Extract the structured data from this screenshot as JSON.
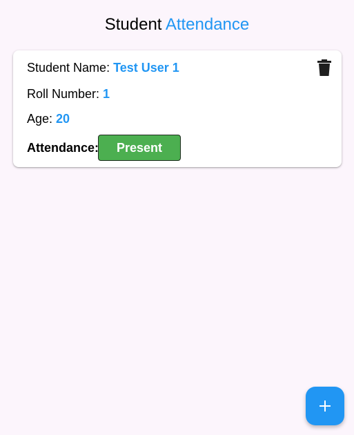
{
  "header": {
    "title_prefix": "Student",
    "title_accent": "Attendance"
  },
  "student": {
    "name_label": "Student Name:",
    "name_value": "Test User 1",
    "roll_label": "Roll Number:",
    "roll_value": "1",
    "age_label": "Age:",
    "age_value": "20",
    "attendance_label": "Attendance:",
    "attendance_value": "Present"
  },
  "icons": {
    "delete": "trash-icon",
    "fab": "plus-icon"
  },
  "colors": {
    "accent": "#2196f3",
    "present": "#4caf50",
    "background": "#fcf5fc"
  }
}
